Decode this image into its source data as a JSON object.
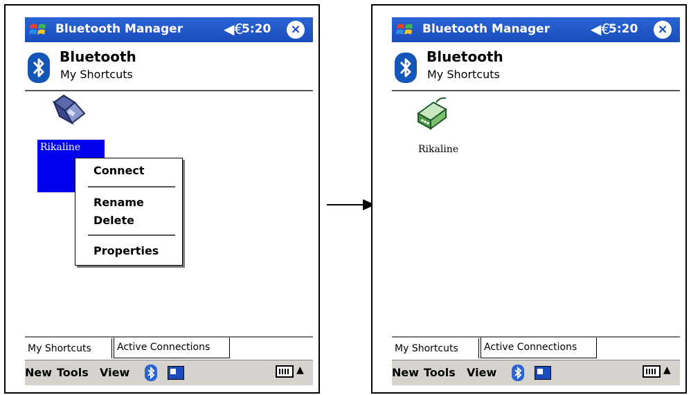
{
  "screens": [
    {
      "title": "Bluetooth Manager",
      "speaker_icon": "◀€",
      "time": "5:20",
      "close_icon": "×",
      "header_title": "Bluetooth",
      "header_subtitle": "My Shortcuts",
      "shortcut_label": "Rikaline",
      "context_menu": {
        "connect": "Connect",
        "rename": "Rename",
        "delete": "Delete",
        "properties": "Properties"
      },
      "tabs": [
        "My Shortcuts",
        "Active Connections"
      ],
      "menu": [
        "New",
        "Tools",
        "View"
      ],
      "kbd_arrow": "▲"
    },
    {
      "title": "Bluetooth Manager",
      "speaker_icon": "◀€",
      "time": "5:20",
      "close_icon": "×",
      "header_title": "Bluetooth",
      "header_subtitle": "My Shortcuts",
      "shortcut_label": "Rikaline",
      "tabs": [
        "My Shortcuts",
        "Active Connections"
      ],
      "menu": [
        "New",
        "Tools",
        "View"
      ],
      "kbd_arrow": "▲"
    }
  ],
  "colors": {
    "titlebar": "#1a4cbc",
    "selection": "#0000ee",
    "bluetooth": "#1456b8",
    "command_bar": "#d6d3ce"
  },
  "icons": {
    "start": "windows-flag-icon",
    "speaker": "speaker-icon",
    "close": "close-icon",
    "bluetooth": "bluetooth-icon",
    "shortcut_left": "serial-port-device-icon",
    "shortcut_right": "serial-connector-icon",
    "keyboard": "keyboard-icon"
  }
}
